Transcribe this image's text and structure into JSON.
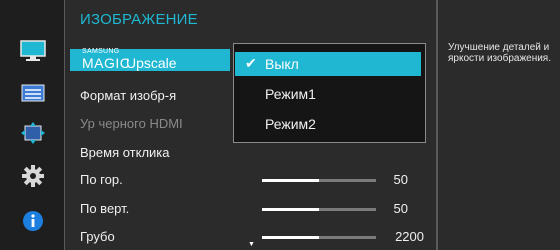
{
  "sidebar": {
    "items": [
      {
        "icon": "picture-monitor-icon"
      },
      {
        "icon": "screen-adjust-icon"
      },
      {
        "icon": "position-arrows-icon"
      },
      {
        "icon": "gear-icon"
      },
      {
        "icon": "info-icon"
      }
    ]
  },
  "menu": {
    "title": "ИЗОБРАЖЕНИЕ",
    "magic_top": "SAMSUNG",
    "magic_word": "MAGIC",
    "magic_upscale": "Upscale",
    "items": [
      {
        "label": "Формат изобр-я"
      },
      {
        "label": "Ур черного HDMI"
      },
      {
        "label": "Время отклика"
      },
      {
        "label": "По гор.",
        "value": "50",
        "level": 0.5
      },
      {
        "label": "По верт.",
        "value": "50",
        "level": 0.5
      },
      {
        "label": "Грубо",
        "value": "2200",
        "level": 0.5
      }
    ]
  },
  "dropdown": {
    "options": [
      {
        "label": "Выкл",
        "selected": true
      },
      {
        "label": "Режим1",
        "selected": false
      },
      {
        "label": "Режим2",
        "selected": false
      }
    ],
    "check_mark": "✔"
  },
  "help": {
    "text": "Улучшение деталей и яркости изображения."
  },
  "scroll_indicator": "▼",
  "colors": {
    "accent": "#1fb7d2",
    "panel": "#2b2b2b",
    "sidebar": "#1e1e1e",
    "dropdown": "#151515"
  }
}
